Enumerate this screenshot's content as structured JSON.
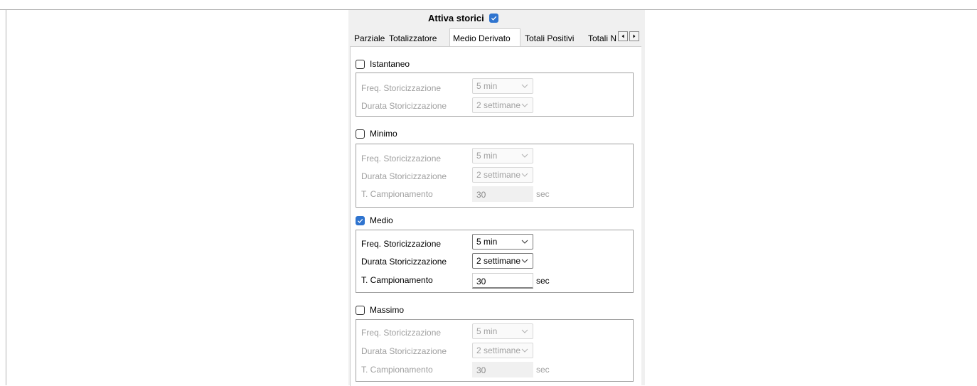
{
  "header": {
    "label": "Attiva storici",
    "checked": true
  },
  "tabs": [
    {
      "label": "Parziale"
    },
    {
      "label": "Totalizzatore"
    },
    {
      "label": "Medio Derivato",
      "active": true
    },
    {
      "label": "Totali Positivi"
    },
    {
      "label": "Totali N"
    }
  ],
  "sections": {
    "istantaneo": {
      "label": "Istantaneo",
      "checked": false,
      "freq_label": "Freq. Storicizzazione",
      "freq_value": "5 min",
      "durata_label": "Durata Storicizzazione",
      "durata_value": "2 settimane"
    },
    "minimo": {
      "label": "Minimo",
      "checked": false,
      "freq_label": "Freq. Storicizzazione",
      "freq_value": "5 min",
      "durata_label": "Durata Storicizzazione",
      "durata_value": "2 settimane",
      "camp_label": "T. Campionamento",
      "camp_value": "30",
      "camp_unit": "sec"
    },
    "medio": {
      "label": "Medio",
      "checked": true,
      "freq_label": "Freq. Storicizzazione",
      "freq_value": "5 min",
      "durata_label": "Durata Storicizzazione",
      "durata_value": "2 settimane",
      "camp_label": "T. Campionamento",
      "camp_value": "30",
      "camp_unit": "sec"
    },
    "massimo": {
      "label": "Massimo",
      "checked": false,
      "freq_label": "Freq. Storicizzazione",
      "freq_value": "5 min",
      "durata_label": "Durata Storicizzazione",
      "durata_value": "2 settimane",
      "camp_label": "T. Campionamento",
      "camp_value": "30",
      "camp_unit": "sec"
    }
  },
  "colors": {
    "accent": "#2f74cf",
    "disabled_text": "#a0a0a0"
  }
}
